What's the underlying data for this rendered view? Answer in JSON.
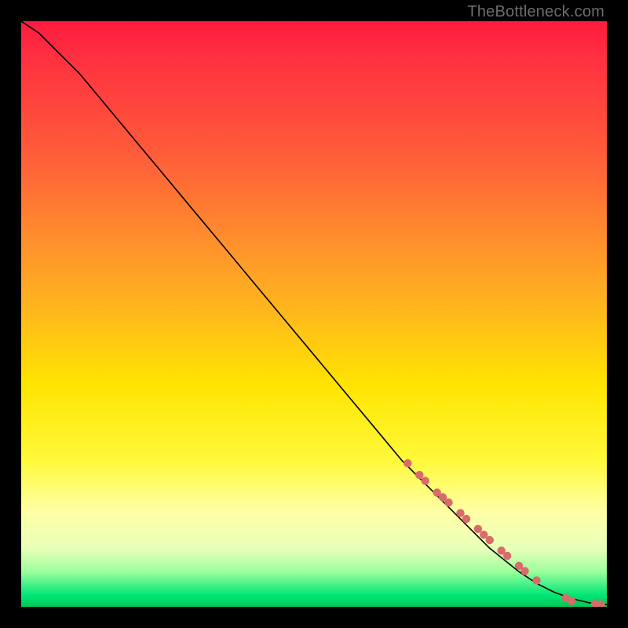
{
  "watermark": "TheBottleneck.com",
  "chart_data": {
    "type": "line",
    "title": "",
    "xlabel": "",
    "ylabel": "",
    "xlim": [
      0,
      100
    ],
    "ylim": [
      0,
      100
    ],
    "grid": false,
    "series": [
      {
        "name": "curve",
        "x": [
          0,
          3,
          6,
          10,
          15,
          20,
          25,
          30,
          35,
          40,
          45,
          50,
          55,
          60,
          65,
          70,
          75,
          80,
          85,
          88,
          91,
          94,
          97,
          100
        ],
        "y": [
          100,
          98,
          95,
          91,
          85,
          79,
          73,
          67,
          61,
          55,
          49,
          43,
          37,
          31,
          25,
          20,
          15,
          10,
          6,
          4,
          2.5,
          1.4,
          0.7,
          0.4
        ]
      }
    ],
    "markers": {
      "name": "highlight-segments",
      "color": "#d96b6b",
      "x": [
        66,
        68,
        69,
        71,
        72,
        73,
        75,
        76,
        78,
        79,
        80,
        82,
        83,
        85,
        86,
        88,
        93,
        94,
        98,
        99
      ],
      "y": [
        24.5,
        22.5,
        21.5,
        19.5,
        18.7,
        17.8,
        16.0,
        15.0,
        13.3,
        12.3,
        11.4,
        9.6,
        8.7,
        7.0,
        6.1,
        4.5,
        1.5,
        1.0,
        0.5,
        0.4
      ]
    },
    "gradient_stops": [
      {
        "pos": 0.0,
        "color": "#ff1a3f"
      },
      {
        "pos": 0.06,
        "color": "#ff3040"
      },
      {
        "pos": 0.22,
        "color": "#ff5a3a"
      },
      {
        "pos": 0.36,
        "color": "#ff8a2e"
      },
      {
        "pos": 0.48,
        "color": "#ffb21f"
      },
      {
        "pos": 0.62,
        "color": "#ffe400"
      },
      {
        "pos": 0.75,
        "color": "#fff93a"
      },
      {
        "pos": 0.84,
        "color": "#ffffa8"
      },
      {
        "pos": 0.9,
        "color": "#e8ffb8"
      },
      {
        "pos": 0.94,
        "color": "#9cff9c"
      },
      {
        "pos": 0.98,
        "color": "#00e676"
      },
      {
        "pos": 1.0,
        "color": "#00c853"
      }
    ]
  }
}
